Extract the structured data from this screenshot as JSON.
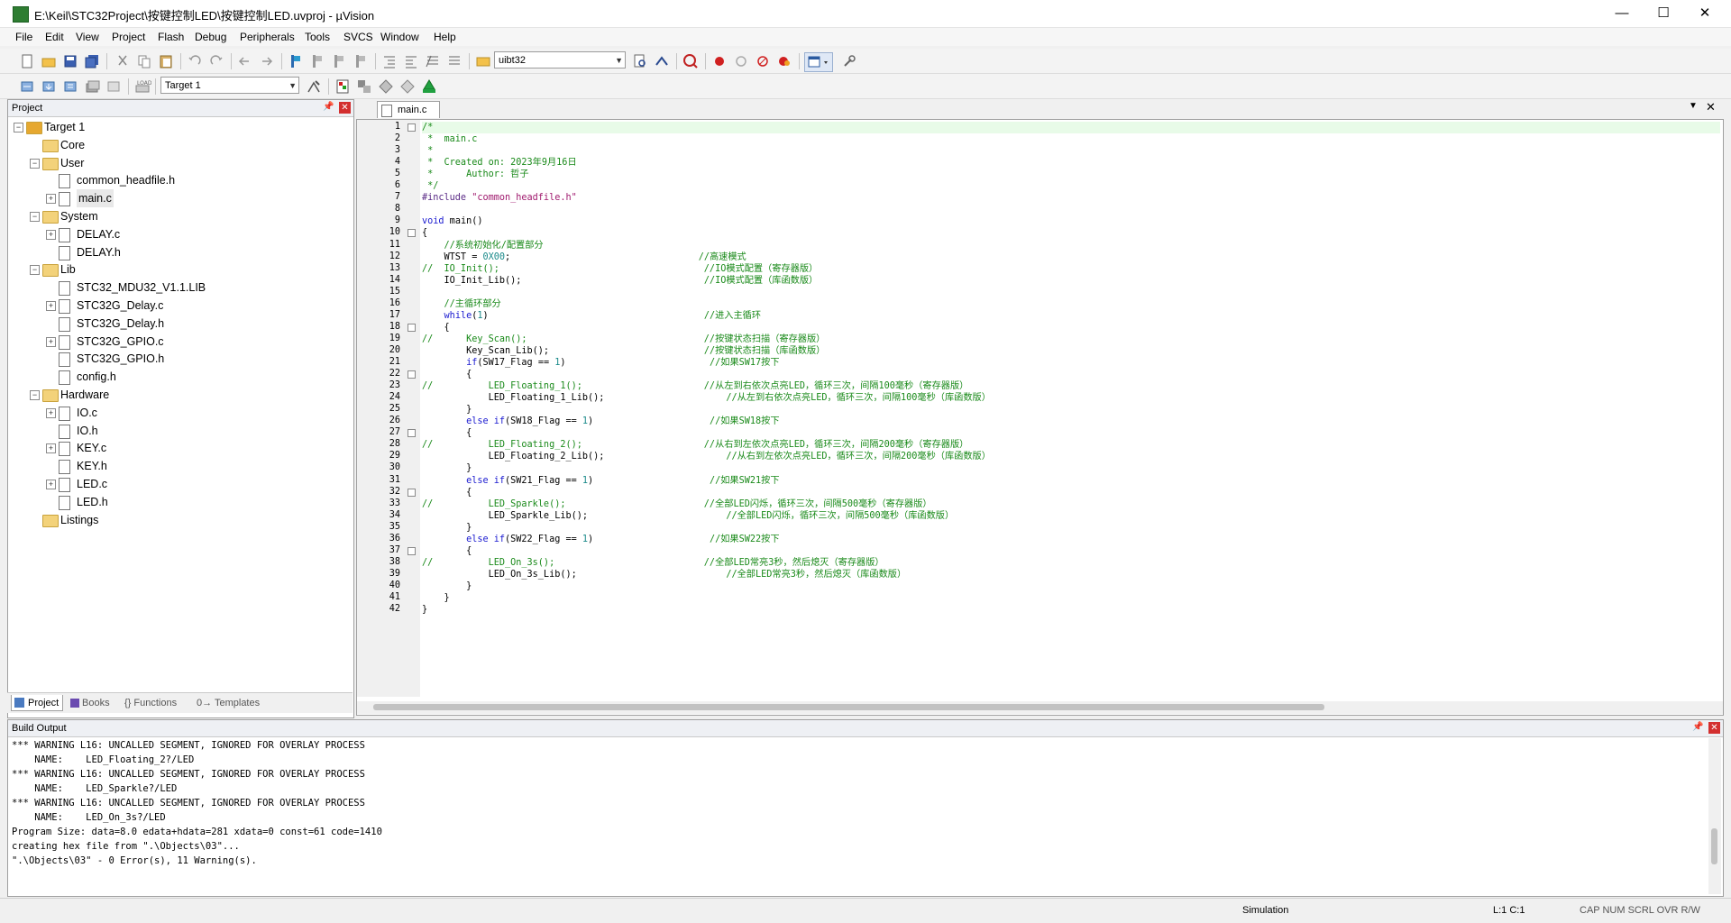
{
  "window": {
    "title": "E:\\Keil\\STC32Project\\按键控制LED\\按键控制LED.uvproj - µVision",
    "minimize": "—",
    "maximize": "☐",
    "close": "✕"
  },
  "menu": [
    "File",
    "Edit",
    "View",
    "Project",
    "Flash",
    "Debug",
    "Peripherals",
    "Tools",
    "SVCS",
    "Window",
    "Help"
  ],
  "toolbar": {
    "find_combo": "uibt32",
    "target_combo": "Target 1"
  },
  "project_panel": {
    "title": "Project",
    "tree": [
      {
        "label": "Target 1",
        "level": 0,
        "kind": "target",
        "expander": "−"
      },
      {
        "label": "Core",
        "level": 1,
        "kind": "folder",
        "expander": ""
      },
      {
        "label": "User",
        "level": 1,
        "kind": "folder",
        "expander": "−"
      },
      {
        "label": "common_headfile.h",
        "level": 2,
        "kind": "file",
        "expander": ""
      },
      {
        "label": "main.c",
        "level": 2,
        "kind": "file",
        "expander": "+"
      },
      {
        "label": "System",
        "level": 1,
        "kind": "folder",
        "expander": "−"
      },
      {
        "label": "DELAY.c",
        "level": 2,
        "kind": "file",
        "expander": "+"
      },
      {
        "label": "DELAY.h",
        "level": 2,
        "kind": "file",
        "expander": ""
      },
      {
        "label": "Lib",
        "level": 1,
        "kind": "folder",
        "expander": "−"
      },
      {
        "label": "STC32_MDU32_V1.1.LIB",
        "level": 2,
        "kind": "file",
        "expander": ""
      },
      {
        "label": "STC32G_Delay.c",
        "level": 2,
        "kind": "file",
        "expander": "+"
      },
      {
        "label": "STC32G_Delay.h",
        "level": 2,
        "kind": "file",
        "expander": ""
      },
      {
        "label": "STC32G_GPIO.c",
        "level": 2,
        "kind": "file",
        "expander": "+"
      },
      {
        "label": "STC32G_GPIO.h",
        "level": 2,
        "kind": "file",
        "expander": ""
      },
      {
        "label": "config.h",
        "level": 2,
        "kind": "file",
        "expander": ""
      },
      {
        "label": "Hardware",
        "level": 1,
        "kind": "folder",
        "expander": "−"
      },
      {
        "label": "IO.c",
        "level": 2,
        "kind": "file",
        "expander": "+"
      },
      {
        "label": "IO.h",
        "level": 2,
        "kind": "file",
        "expander": ""
      },
      {
        "label": "KEY.c",
        "level": 2,
        "kind": "file",
        "expander": "+"
      },
      {
        "label": "KEY.h",
        "level": 2,
        "kind": "file",
        "expander": ""
      },
      {
        "label": "LED.c",
        "level": 2,
        "kind": "file",
        "expander": "+"
      },
      {
        "label": "LED.h",
        "level": 2,
        "kind": "file",
        "expander": ""
      },
      {
        "label": "Listings",
        "level": 1,
        "kind": "folder",
        "expander": ""
      }
    ],
    "tabs": [
      "Project",
      "Books",
      "{} Functions",
      "0→ Templates"
    ]
  },
  "editor": {
    "tab_label": "main.c",
    "line_numbers": [
      "1",
      "2",
      "3",
      "4",
      "5",
      "6",
      "7",
      "8",
      "9",
      "10",
      "11",
      "12",
      "13",
      "14",
      "15",
      "16",
      "17",
      "18",
      "19",
      "20",
      "21",
      "22",
      "23",
      "24",
      "25",
      "26",
      "27",
      "28",
      "29",
      "30",
      "31",
      "32",
      "33",
      "34",
      "35",
      "36",
      "37",
      "38",
      "39",
      "40",
      "41",
      "42"
    ],
    "lines": [
      [
        {
          "t": "/*",
          "c": "cmt"
        }
      ],
      [
        {
          "t": " *  main.c",
          "c": "cmt"
        }
      ],
      [
        {
          "t": " *",
          "c": "cmt"
        }
      ],
      [
        {
          "t": " *  Created on: 2023年9月16日",
          "c": "cmt"
        }
      ],
      [
        {
          "t": " *      Author: 哲子",
          "c": "cmt"
        }
      ],
      [
        {
          "t": " */",
          "c": "cmt"
        }
      ],
      [
        {
          "t": "#include ",
          "c": "pp"
        },
        {
          "t": "\"common_headfile.h\"",
          "c": "str"
        }
      ],
      [
        {
          "t": "",
          "c": ""
        }
      ],
      [
        {
          "t": "void",
          "c": "kw"
        },
        {
          "t": " main()",
          "c": ""
        }
      ],
      [
        {
          "t": "{",
          "c": ""
        }
      ],
      [
        {
          "t": "    //系统初始化/配置部分",
          "c": "cmt"
        }
      ],
      [
        {
          "t": "    WTST = ",
          "c": ""
        },
        {
          "t": "0X00",
          "c": "num"
        },
        {
          "t": ";                                  ",
          "c": ""
        },
        {
          "t": "//高速模式",
          "c": "cmt"
        }
      ],
      [
        {
          "t": "//  IO_Init();                                     //IO模式配置（寄存器版）",
          "c": "cmt"
        }
      ],
      [
        {
          "t": "    IO_Init_Lib();                                 ",
          "c": ""
        },
        {
          "t": "//IO模式配置（库函数版）",
          "c": "cmt"
        }
      ],
      [
        {
          "t": "",
          "c": ""
        }
      ],
      [
        {
          "t": "    //主循环部分",
          "c": "cmt"
        }
      ],
      [
        {
          "t": "    ",
          "c": ""
        },
        {
          "t": "while",
          "c": "kw"
        },
        {
          "t": "(",
          "c": ""
        },
        {
          "t": "1",
          "c": "num"
        },
        {
          "t": ")                                       ",
          "c": ""
        },
        {
          "t": "//进入主循环",
          "c": "cmt"
        }
      ],
      [
        {
          "t": "    {",
          "c": ""
        }
      ],
      [
        {
          "t": "//      Key_Scan();                                //按键状态扫描（寄存器版）",
          "c": "cmt"
        }
      ],
      [
        {
          "t": "        Key_Scan_Lib();                            ",
          "c": ""
        },
        {
          "t": "//按键状态扫描（库函数版）",
          "c": "cmt"
        }
      ],
      [
        {
          "t": "        ",
          "c": ""
        },
        {
          "t": "if",
          "c": "kw"
        },
        {
          "t": "(SW17_Flag == ",
          "c": ""
        },
        {
          "t": "1",
          "c": "num"
        },
        {
          "t": ")                          ",
          "c": ""
        },
        {
          "t": "//如果SW17按下",
          "c": "cmt"
        }
      ],
      [
        {
          "t": "        {",
          "c": ""
        }
      ],
      [
        {
          "t": "//          LED_Floating_1();                      //从左到右依次点亮LED，循环三次，间隔100毫秒（寄存器版）",
          "c": "cmt"
        }
      ],
      [
        {
          "t": "            LED_Floating_1_Lib();                      ",
          "c": ""
        },
        {
          "t": "//从左到右依次点亮LED，循环三次，间隔100毫秒（库函数版）",
          "c": "cmt"
        }
      ],
      [
        {
          "t": "        }",
          "c": ""
        }
      ],
      [
        {
          "t": "        ",
          "c": ""
        },
        {
          "t": "else if",
          "c": "kw"
        },
        {
          "t": "(SW18_Flag == ",
          "c": ""
        },
        {
          "t": "1",
          "c": "num"
        },
        {
          "t": ")                     ",
          "c": ""
        },
        {
          "t": "//如果SW18按下",
          "c": "cmt"
        }
      ],
      [
        {
          "t": "        {",
          "c": ""
        }
      ],
      [
        {
          "t": "//          LED_Floating_2();                      //从右到左依次点亮LED，循环三次，间隔200毫秒（寄存器版）",
          "c": "cmt"
        }
      ],
      [
        {
          "t": "            LED_Floating_2_Lib();                      ",
          "c": ""
        },
        {
          "t": "//从右到左依次点亮LED，循环三次，间隔200毫秒（库函数版）",
          "c": "cmt"
        }
      ],
      [
        {
          "t": "        }",
          "c": ""
        }
      ],
      [
        {
          "t": "        ",
          "c": ""
        },
        {
          "t": "else if",
          "c": "kw"
        },
        {
          "t": "(SW21_Flag == ",
          "c": ""
        },
        {
          "t": "1",
          "c": "num"
        },
        {
          "t": ")                     ",
          "c": ""
        },
        {
          "t": "//如果SW21按下",
          "c": "cmt"
        }
      ],
      [
        {
          "t": "        {",
          "c": ""
        }
      ],
      [
        {
          "t": "//          LED_Sparkle();                         //全部LED闪烁，循环三次，间隔500毫秒（寄存器版）",
          "c": "cmt"
        }
      ],
      [
        {
          "t": "            LED_Sparkle_Lib();                         ",
          "c": ""
        },
        {
          "t": "//全部LED闪烁，循环三次，间隔500毫秒（库函数版）",
          "c": "cmt"
        }
      ],
      [
        {
          "t": "        }",
          "c": ""
        }
      ],
      [
        {
          "t": "        ",
          "c": ""
        },
        {
          "t": "else if",
          "c": "kw"
        },
        {
          "t": "(SW22_Flag == ",
          "c": ""
        },
        {
          "t": "1",
          "c": "num"
        },
        {
          "t": ")                     ",
          "c": ""
        },
        {
          "t": "//如果SW22按下",
          "c": "cmt"
        }
      ],
      [
        {
          "t": "        {",
          "c": ""
        }
      ],
      [
        {
          "t": "//          LED_On_3s();                           //全部LED常亮3秒，然后熄灭（寄存器版）",
          "c": "cmt"
        }
      ],
      [
        {
          "t": "            LED_On_3s_Lib();                           ",
          "c": ""
        },
        {
          "t": "//全部LED常亮3秒，然后熄灭（库函数版）",
          "c": "cmt"
        }
      ],
      [
        {
          "t": "        }",
          "c": ""
        }
      ],
      [
        {
          "t": "    }",
          "c": ""
        }
      ],
      [
        {
          "t": "}",
          "c": ""
        }
      ]
    ]
  },
  "build_output": {
    "title": "Build Output",
    "lines": [
      "*** WARNING L16: UNCALLED SEGMENT, IGNORED FOR OVERLAY PROCESS",
      "    NAME:    LED_Floating_2?/LED",
      "*** WARNING L16: UNCALLED SEGMENT, IGNORED FOR OVERLAY PROCESS",
      "    NAME:    LED_Sparkle?/LED",
      "*** WARNING L16: UNCALLED SEGMENT, IGNORED FOR OVERLAY PROCESS",
      "    NAME:    LED_On_3s?/LED",
      "Program Size: data=8.0 edata+hdata=281 xdata=0 const=61 code=1410",
      "creating hex file from \".\\Objects\\03\"...",
      "\".\\Objects\\03\" - 0 Error(s), 11 Warning(s)."
    ]
  },
  "status": {
    "mode": "Simulation",
    "position": "L:1 C:1",
    "caps": "CAP  NUM  SCRL  OVR  R/W"
  },
  "colors": {
    "comment": "#1a8a1a",
    "keyword": "#1a1ad0",
    "number": "#1a8a8a",
    "string": "#a01a6e",
    "close_red": "#d32f2f"
  }
}
